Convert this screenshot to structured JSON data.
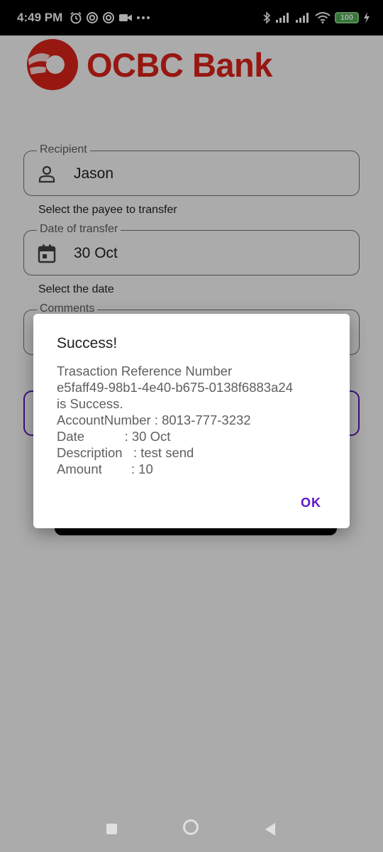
{
  "status_bar": {
    "time": "4:49 PM",
    "left_icons": [
      "alarm-icon",
      "sync-icon",
      "sync-icon",
      "video-icon",
      "more-icon"
    ],
    "right_icons": [
      "bluetooth-icon",
      "signal-icon",
      "signal-icon",
      "wifi-icon",
      "battery-icon"
    ],
    "battery_level": "100"
  },
  "app": {
    "logo_text": "OCBC Bank",
    "brand_color": "#e2231a",
    "accent_color": "#5c16c5"
  },
  "form": {
    "recipient": {
      "label": "Recipient",
      "value": "Jason",
      "helper": "Select the payee to transfer",
      "icon": "person-icon"
    },
    "date": {
      "label": "Date of transfer",
      "value": "30 Oct",
      "helper": "Select the date",
      "icon": "calendar-icon"
    },
    "comments": {
      "label": "Comments"
    }
  },
  "dialog": {
    "title": "Success!",
    "lines": [
      "Trasaction Reference Number",
      "e5faff49-98b1-4e40-b675-0138f6883a24",
      "is Success.",
      "AccountNumber : 8013-777-3232",
      "Date           : 30 Oct",
      "Description   : test send",
      "Amount        : 10"
    ],
    "ok_label": "OK"
  },
  "nav_bar": {
    "buttons": [
      "recents-button",
      "home-button",
      "back-button"
    ]
  }
}
